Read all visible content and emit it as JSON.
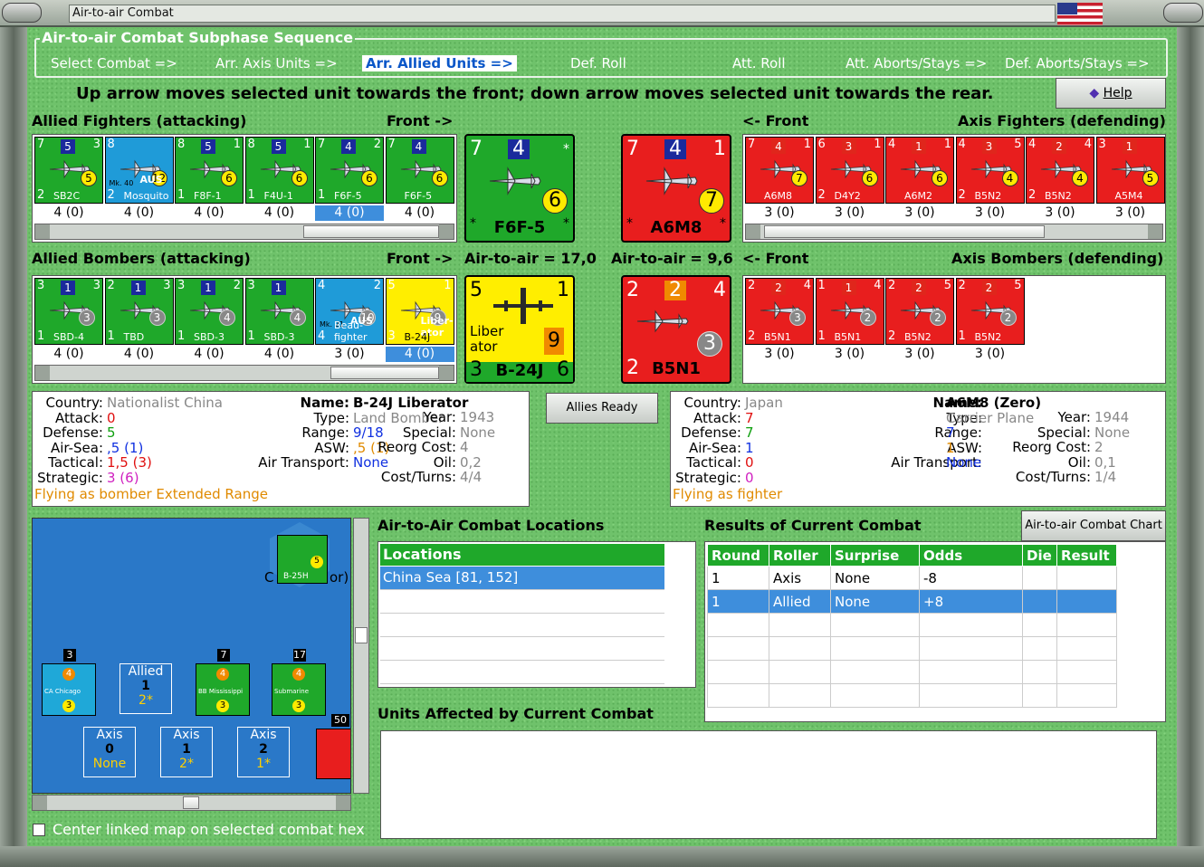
{
  "window": {
    "title": "Air-to-air Combat"
  },
  "sequence": {
    "title": "Air-to-air Combat Subphase Sequence",
    "steps": [
      "Select Combat =>",
      "Arr. Axis Units =>",
      "Arr. Allied Units =>",
      "Def. Roll",
      "Att. Roll",
      "Att. Aborts/Stays =>",
      "Def. Aborts/Stays =>"
    ],
    "active_index": 2
  },
  "instruction": "Up arrow moves selected unit towards the front; down arrow moves selected unit towards the rear.",
  "help_label": "Help",
  "allied_fighters": {
    "label": "Allied Fighters (attacking)",
    "front": "Front ->",
    "units": [
      {
        "tl": "7",
        "mid": "5",
        "tr": "3",
        "bl": "2",
        "name": "SB2C",
        "y": "5",
        "val": "4 (0)",
        "color": "g"
      },
      {
        "tl": "8",
        "mid": "",
        "tr": "",
        "bl": "2",
        "name": "Mosquito",
        "y": "12",
        "val": "4 (0)",
        "color": "b",
        "extra": "AUS",
        "mk": "Mk. 40"
      },
      {
        "tl": "8",
        "mid": "5",
        "tr": "1",
        "bl": "1",
        "name": "F8F-1",
        "y": "6",
        "val": "4 (0)",
        "color": "g"
      },
      {
        "tl": "8",
        "mid": "5",
        "tr": "1",
        "bl": "1",
        "name": "F4U-1",
        "y": "6",
        "val": "4 (0)",
        "color": "g"
      },
      {
        "tl": "7",
        "mid": "4",
        "tr": "2",
        "bl": "1",
        "name": "F6F-5",
        "y": "6",
        "val": "4 (0)",
        "color": "g",
        "sel": true
      },
      {
        "tl": "7",
        "mid": "4",
        "tr": "",
        "bl": "",
        "name": "F6F-5",
        "y": "6",
        "val": "4 (0)",
        "color": "g"
      }
    ]
  },
  "axis_fighters": {
    "label": "Axis Fighters (defending)",
    "front": "<- Front",
    "units": [
      {
        "tl": "7",
        "mid": "4",
        "tr": "1",
        "bl": "",
        "name": "A6M8",
        "y": "7",
        "val": "3 (0)",
        "color": "r"
      },
      {
        "tl": "6",
        "mid": "3",
        "tr": "1",
        "bl": "2",
        "name": "D4Y2",
        "y": "6",
        "val": "3 (0)",
        "color": "r"
      },
      {
        "tl": "4",
        "mid": "1",
        "tr": "1",
        "bl": "",
        "name": "A6M2",
        "y": "6",
        "val": "3 (0)",
        "color": "r"
      },
      {
        "tl": "4",
        "mid": "3",
        "tr": "5",
        "bl": "2",
        "name": "B5N2",
        "y": "4",
        "val": "3 (0)",
        "color": "r"
      },
      {
        "tl": "4",
        "mid": "2",
        "tr": "4",
        "bl": "2",
        "name": "B5N2",
        "y": "4",
        "val": "3 (0)",
        "color": "r"
      },
      {
        "tl": "3",
        "mid": "1",
        "tr": "",
        "bl": "",
        "name": "A5M4",
        "y": "5",
        "val": "3 (0)",
        "color": "r"
      }
    ]
  },
  "big_allied_fighter": {
    "tl": "7",
    "mid": "4",
    "tr": "*",
    "y": "6",
    "name": "F6F-5",
    "bl": "*",
    "br": "*"
  },
  "big_axis_fighter": {
    "tl": "7",
    "mid": "4",
    "tr": "1",
    "y": "7",
    "name": "A6M8",
    "bl": "*",
    "br": "*"
  },
  "allied_bombers": {
    "label": "Allied Bombers (attacking)",
    "front": "Front ->",
    "units": [
      {
        "tl": "3",
        "mid": "1",
        "tr": "3",
        "bl": "1",
        "name": "SBD-4",
        "g": "3",
        "val": "4 (0)",
        "color": "g"
      },
      {
        "tl": "2",
        "mid": "1",
        "tr": "3",
        "bl": "1",
        "name": "TBD",
        "g": "3",
        "val": "4 (0)",
        "color": "g"
      },
      {
        "tl": "3",
        "mid": "1",
        "tr": "2",
        "bl": "1",
        "name": "SBD-3",
        "g": "4",
        "val": "4 (0)",
        "color": "g"
      },
      {
        "tl": "3",
        "mid": "1",
        "tr": "",
        "bl": "1",
        "name": "SBD-3",
        "g": "4",
        "val": "4 (0)",
        "color": "g"
      },
      {
        "tl": "4",
        "mid": "",
        "tr": "2",
        "bl": "4",
        "name": "Beau-fighter",
        "g": "10",
        "val": "3 (0)",
        "color": "b",
        "extra": "AUS",
        "mk": "Mk. 21"
      },
      {
        "tl": "5",
        "mid": "",
        "tr": "1",
        "bl": "3",
        "name": "B-24J",
        "g": "9",
        "val": "4 (0)",
        "color": "y",
        "sel": true,
        "extra": "Liber-ator"
      }
    ]
  },
  "axis_bombers": {
    "label": "Axis Bombers (defending)",
    "front": "<- Front",
    "units": [
      {
        "tl": "2",
        "mid": "2",
        "tr": "4",
        "bl": "2",
        "name": "B5N1",
        "g": "3",
        "val": "3 (0)",
        "color": "r"
      },
      {
        "tl": "1",
        "mid": "1",
        "tr": "4",
        "bl": "1",
        "name": "B5N1",
        "g": "2",
        "val": "3 (0)",
        "color": "r"
      },
      {
        "tl": "2",
        "mid": "2",
        "tr": "5",
        "bl": "2",
        "name": "B5N2",
        "g": "2",
        "val": "3 (0)",
        "color": "r"
      },
      {
        "tl": "2",
        "mid": "2",
        "tr": "5",
        "bl": "1",
        "name": "B5N2",
        "g": "2",
        "val": "3 (0)",
        "color": "r"
      }
    ]
  },
  "big_allied_bomber": {
    "tl": "5",
    "tr": "1",
    "label": "Liber ator",
    "y": "9",
    "bl": "3",
    "name": "B-24J",
    "br": "6"
  },
  "big_axis_bomber": {
    "tl": "2",
    "mid": "2",
    "tr": "4",
    "g": "3",
    "bl": "2",
    "name": "B5N1"
  },
  "odds_allied": "Air-to-air = 17,0",
  "odds_axis": "Air-to-air = 9,6",
  "allied_info": {
    "country_k": "Country:",
    "country": "Nationalist China",
    "attack_k": "Attack:",
    "attack": "0",
    "defense_k": "Defense:",
    "defense": "5",
    "airsea_k": "Air-Sea:",
    "airsea": ",5 (1)",
    "tactical_k": "Tactical:",
    "tactical": "1,5 (3)",
    "strategic_k": "Strategic:",
    "strategic": "3 (6)",
    "flying": "Flying as bomber",
    "flying2": "Extended Range",
    "name_k": "Name:",
    "name": "B-24J Liberator",
    "type_k": "Type:",
    "type": "Land Bomber",
    "year_k": "Year:",
    "year": "1943",
    "range_k": "Range:",
    "range": "9/18",
    "special_k": "Special:",
    "special": "None",
    "asw_k": "ASW:",
    "asw": ",5 (1)",
    "reorg_k": "Reorg Cost:",
    "reorg": "4",
    "oil_k": "Oil:",
    "oil": "0,2",
    "airtrans_k": "Air Transport:",
    "airtrans": "None",
    "cost_k": "Cost/Turns:",
    "cost": "4/4"
  },
  "allies_ready": "Allies Ready",
  "axis_info": {
    "country_k": "Country:",
    "country": "Japan",
    "attack_k": "Attack:",
    "attack": "7",
    "defense_k": "Defense:",
    "defense": "7",
    "airsea_k": "Air-Sea:",
    "airsea": "1",
    "tactical_k": "Tactical:",
    "tactical": "0",
    "strategic_k": "Strategic:",
    "strategic": "0",
    "flying": "Flying as fighter",
    "name_k": "Name:",
    "name": "A6M8 (Zero)",
    "type_k": "Type:",
    "type": "Carrier Plane",
    "year_k": "Year:",
    "year": "1944",
    "range_k": "Range:",
    "range": "7",
    "special_k": "Special:",
    "special": "None",
    "asw_k": "ASW:",
    "asw": "1",
    "reorg_k": "Reorg Cost:",
    "reorg": "2",
    "oil_k": "Oil:",
    "oil": "0,1",
    "airtrans_k": "Air Transport:",
    "airtrans": "None",
    "cost_k": "Cost/Turns:",
    "cost": "1/4"
  },
  "locations": {
    "title": "Air-to-Air Combat Locations",
    "header": "Locations",
    "rows": [
      "China Sea [81, 152]"
    ]
  },
  "results": {
    "title": "Results of Current Combat",
    "chart_btn": "Air-to-air Combat Chart",
    "headers": [
      "Round",
      "Roller",
      "Surprise",
      "Odds",
      "Die",
      "Result"
    ],
    "rows": [
      [
        "1",
        "Axis",
        "None",
        "-8",
        "",
        ""
      ],
      [
        "1",
        "Allied",
        "None",
        "+8",
        "",
        ""
      ]
    ]
  },
  "units_affected": "Units Affected by Current Combat",
  "map": {
    "boxes": [
      {
        "h": "Allied",
        "a": "1",
        "b": "2*"
      },
      {
        "h": "Axis",
        "a": "0",
        "b": "None"
      },
      {
        "h": "Axis",
        "a": "1",
        "b": "2*"
      },
      {
        "h": "Axis",
        "a": "2",
        "b": "1*"
      }
    ],
    "stack_counts": [
      "3",
      "7",
      "17",
      "50"
    ],
    "hex_label": "B-25H",
    "hex_c": "C",
    "hex_r": "or)",
    "ships": [
      "CA Chicago",
      "BB Mississippi",
      "Submarine"
    ]
  },
  "center_map": "Center linked map on selected combat hex"
}
